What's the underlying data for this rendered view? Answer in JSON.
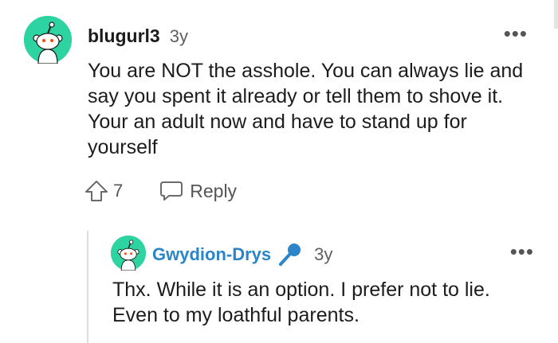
{
  "comment": {
    "username": "blugurl3",
    "age": "3y",
    "more_label": "•••",
    "body": "You are NOT the asshole. You can always lie and say you spent it already or tell them to shove it. Your an adult now and have to stand up for yourself",
    "votes": "7",
    "reply_label": "Reply",
    "avatar_color": "#2ED3A2"
  },
  "reply": {
    "username": "Gwydion-Drys",
    "age": "3y",
    "more_label": "•••",
    "body": "Thx. While it is an option. I prefer not to lie. Even to my loathful parents.",
    "flair_icon": "microphone-icon",
    "username_color": "#2B85C8",
    "avatar_color": "#2ED3A2"
  }
}
